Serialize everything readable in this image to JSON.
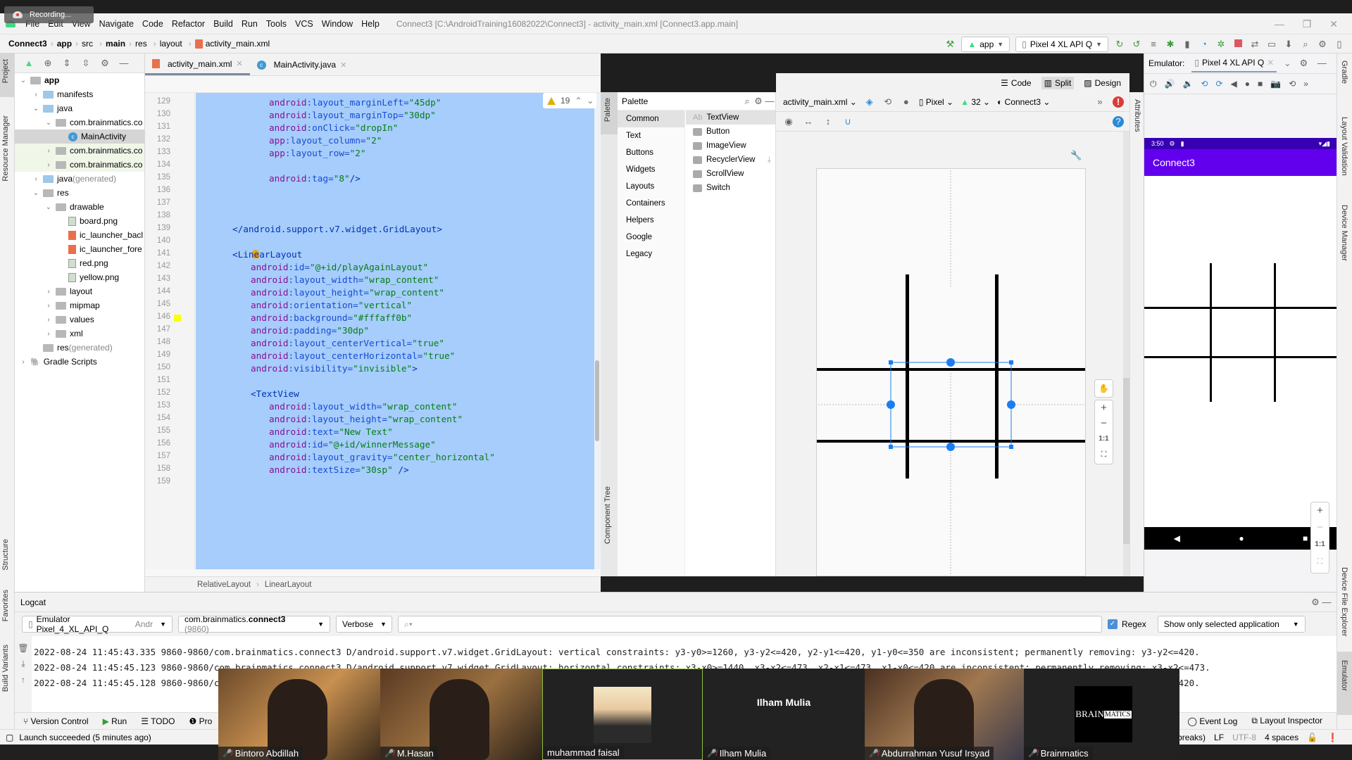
{
  "recording": {
    "label": "Recording..."
  },
  "menu": {
    "items": [
      "File",
      "Edit",
      "View",
      "Navigate",
      "Code",
      "Refactor",
      "Build",
      "Run",
      "Tools",
      "VCS",
      "Window",
      "Help"
    ],
    "window_title": "Connect3 [C:\\AndroidTraining16082022\\Connect3] - activity_main.xml [Connect3.app.main]"
  },
  "breadcrumb": [
    "Connect3",
    "app",
    "src",
    "main",
    "res",
    "layout",
    "activity_main.xml"
  ],
  "toolbar": {
    "run_config": "app",
    "device": "Pixel 4 XL API Q"
  },
  "project_tree": [
    {
      "label": "app",
      "indent": 0,
      "arrow": "v",
      "icon": "module",
      "bold": true
    },
    {
      "label": "manifests",
      "indent": 1,
      "arrow": ">",
      "icon": "folder-blue"
    },
    {
      "label": "java",
      "indent": 1,
      "arrow": "v",
      "icon": "folder-blue"
    },
    {
      "label": "com.brainmatics.co",
      "indent": 2,
      "arrow": "v",
      "icon": "package"
    },
    {
      "label": "MainActivity",
      "indent": 3,
      "arrow": "",
      "icon": "class",
      "selected": true
    },
    {
      "label": "com.brainmatics.co",
      "indent": 2,
      "arrow": ">",
      "icon": "package",
      "modified": true
    },
    {
      "label": "com.brainmatics.co",
      "indent": 2,
      "arrow": ">",
      "icon": "package",
      "modified": true
    },
    {
      "label": "java",
      "suffix": " (generated)",
      "indent": 1,
      "arrow": ">",
      "icon": "folder-gen"
    },
    {
      "label": "res",
      "indent": 1,
      "arrow": "v",
      "icon": "folder-res"
    },
    {
      "label": "drawable",
      "indent": 2,
      "arrow": "v",
      "icon": "folder"
    },
    {
      "label": "board.png",
      "indent": 3,
      "arrow": "",
      "icon": "image"
    },
    {
      "label": "ic_launcher_bacl",
      "indent": 3,
      "arrow": "",
      "icon": "xml"
    },
    {
      "label": "ic_launcher_fore",
      "indent": 3,
      "arrow": "",
      "icon": "xml"
    },
    {
      "label": "red.png",
      "indent": 3,
      "arrow": "",
      "icon": "image"
    },
    {
      "label": "yellow.png",
      "indent": 3,
      "arrow": "",
      "icon": "image"
    },
    {
      "label": "layout",
      "indent": 2,
      "arrow": ">",
      "icon": "folder"
    },
    {
      "label": "mipmap",
      "indent": 2,
      "arrow": ">",
      "icon": "folder"
    },
    {
      "label": "values",
      "indent": 2,
      "arrow": ">",
      "icon": "folder"
    },
    {
      "label": "xml",
      "indent": 2,
      "arrow": ">",
      "icon": "folder"
    },
    {
      "label": "res",
      "suffix": " (generated)",
      "indent": 1,
      "arrow": "",
      "icon": "folder-res"
    },
    {
      "label": "Gradle Scripts",
      "indent": 0,
      "arrow": ">",
      "icon": "gradle"
    }
  ],
  "left_tool_tabs": [
    "Project",
    "Resource Manager",
    "Structure",
    "Favorites",
    "Build Variants"
  ],
  "right_tool_tabs": [
    "Gradle",
    "Layout Validation",
    "Device Manager",
    "Device File Explorer",
    "Emulator"
  ],
  "editor": {
    "tabs": [
      {
        "label": "activity_main.xml",
        "icon": "xml",
        "active": true
      },
      {
        "label": "MainActivity.java",
        "icon": "class",
        "active": false
      }
    ],
    "warnings": "19",
    "lines": [
      {
        "n": "129",
        "indent": 6,
        "parts": [
          [
            "attr",
            "android"
          ],
          [
            "nm",
            ":layout_marginLeft="
          ],
          [
            "val",
            "\"45dp\""
          ]
        ]
      },
      {
        "n": "130",
        "indent": 6,
        "parts": [
          [
            "attr",
            "android"
          ],
          [
            "nm",
            ":layout_marginTop="
          ],
          [
            "val",
            "\"30dp\""
          ]
        ]
      },
      {
        "n": "131",
        "indent": 6,
        "parts": [
          [
            "attr",
            "android"
          ],
          [
            "nm",
            ":onClick="
          ],
          [
            "val",
            "\"dropIn\""
          ]
        ]
      },
      {
        "n": "132",
        "indent": 6,
        "parts": [
          [
            "attr",
            "app"
          ],
          [
            "nm",
            ":layout_column="
          ],
          [
            "val",
            "\"2\""
          ]
        ]
      },
      {
        "n": "133",
        "indent": 6,
        "parts": [
          [
            "attr",
            "app"
          ],
          [
            "nm",
            ":layout_row="
          ],
          [
            "val",
            "\"2\""
          ]
        ]
      },
      {
        "n": "134",
        "indent": 0,
        "parts": []
      },
      {
        "n": "135",
        "indent": 6,
        "parts": [
          [
            "attr",
            "android"
          ],
          [
            "nm",
            ":tag="
          ],
          [
            "val",
            "\"8\""
          ],
          [
            "tag",
            "/>"
          ]
        ]
      },
      {
        "n": "136",
        "indent": 0,
        "parts": []
      },
      {
        "n": "137",
        "indent": 0,
        "parts": []
      },
      {
        "n": "138",
        "indent": 0,
        "parts": []
      },
      {
        "n": "139",
        "indent": 2,
        "parts": [
          [
            "tag",
            "</android.support.v7.widget.GridLayout>"
          ]
        ]
      },
      {
        "n": "140",
        "indent": 0,
        "parts": []
      },
      {
        "n": "141",
        "indent": 2,
        "parts": [
          [
            "tag",
            "<LinearLayout"
          ]
        ]
      },
      {
        "n": "142",
        "indent": 4,
        "parts": [
          [
            "attr",
            "android"
          ],
          [
            "nm",
            ":id="
          ],
          [
            "val",
            "\"@+id/playAgainLayout\""
          ]
        ]
      },
      {
        "n": "143",
        "indent": 4,
        "parts": [
          [
            "attr",
            "android"
          ],
          [
            "nm",
            ":layout_width="
          ],
          [
            "val",
            "\"wrap_content\""
          ]
        ]
      },
      {
        "n": "144",
        "indent": 4,
        "parts": [
          [
            "attr",
            "android"
          ],
          [
            "nm",
            ":layout_height="
          ],
          [
            "val",
            "\"wrap_content\""
          ]
        ]
      },
      {
        "n": "145",
        "indent": 4,
        "parts": [
          [
            "attr",
            "android"
          ],
          [
            "nm",
            ":orientation="
          ],
          [
            "val",
            "\"vertical\""
          ]
        ]
      },
      {
        "n": "146",
        "indent": 4,
        "parts": [
          [
            "attr",
            "android"
          ],
          [
            "nm",
            ":background="
          ],
          [
            "val",
            "\"#fffaff0b\""
          ]
        ]
      },
      {
        "n": "147",
        "indent": 4,
        "parts": [
          [
            "attr",
            "android"
          ],
          [
            "nm",
            ":padding="
          ],
          [
            "val",
            "\"30dp\""
          ]
        ]
      },
      {
        "n": "148",
        "indent": 4,
        "parts": [
          [
            "attr",
            "android"
          ],
          [
            "nm",
            ":layout_centerVertical="
          ],
          [
            "val",
            "\"true\""
          ]
        ]
      },
      {
        "n": "149",
        "indent": 4,
        "parts": [
          [
            "attr",
            "android"
          ],
          [
            "nm",
            ":layout_centerHorizontal="
          ],
          [
            "val",
            "\"true\""
          ]
        ]
      },
      {
        "n": "150",
        "indent": 4,
        "parts": [
          [
            "attr",
            "android"
          ],
          [
            "nm",
            ":visibility="
          ],
          [
            "val",
            "\"invisible\""
          ],
          [
            "tag",
            ">"
          ]
        ]
      },
      {
        "n": "151",
        "indent": 0,
        "parts": []
      },
      {
        "n": "152",
        "indent": 4,
        "parts": [
          [
            "tag",
            "<TextView"
          ]
        ]
      },
      {
        "n": "153",
        "indent": 6,
        "parts": [
          [
            "attr",
            "android"
          ],
          [
            "nm",
            ":layout_width="
          ],
          [
            "val",
            "\"wrap_content\""
          ]
        ]
      },
      {
        "n": "154",
        "indent": 6,
        "parts": [
          [
            "attr",
            "android"
          ],
          [
            "nm",
            ":layout_height="
          ],
          [
            "val",
            "\"wrap_content\""
          ]
        ]
      },
      {
        "n": "155",
        "indent": 6,
        "parts": [
          [
            "attr",
            "android"
          ],
          [
            "nm",
            ":text="
          ],
          [
            "val",
            "\"New Text\""
          ]
        ]
      },
      {
        "n": "156",
        "indent": 6,
        "parts": [
          [
            "attr",
            "android"
          ],
          [
            "nm",
            ":id="
          ],
          [
            "val",
            "\"@+id/winnerMessage\""
          ]
        ]
      },
      {
        "n": "157",
        "indent": 6,
        "parts": [
          [
            "attr",
            "android"
          ],
          [
            "nm",
            ":layout_gravity="
          ],
          [
            "val",
            "\"center_horizontal\""
          ]
        ]
      },
      {
        "n": "158",
        "indent": 6,
        "parts": [
          [
            "attr",
            "android"
          ],
          [
            "nm",
            ":textSize="
          ],
          [
            "val",
            "\"30sp\""
          ],
          [
            "tag",
            " />"
          ]
        ]
      },
      {
        "n": "159",
        "indent": 0,
        "parts": []
      }
    ],
    "color_swatch": "#fffaff0b",
    "structure_crumbs": [
      "RelativeLayout",
      "LinearLayout"
    ]
  },
  "view_modes": {
    "code": "Code",
    "split": "Split",
    "design": "Design",
    "active": "Split"
  },
  "palette": {
    "title": "Palette",
    "side_tab": "Palette",
    "component_tree_tab": "Component Tree",
    "categories": [
      "Common",
      "Text",
      "Buttons",
      "Widgets",
      "Layouts",
      "Containers",
      "Helpers",
      "Google",
      "Legacy"
    ],
    "selected_category": "Common",
    "widgets": [
      {
        "label": "TextView",
        "icon": "Ab",
        "selected": true
      },
      {
        "label": "Button",
        "icon": "button"
      },
      {
        "label": "ImageView",
        "icon": "image"
      },
      {
        "label": "RecyclerView",
        "icon": "list",
        "download": true
      },
      {
        "label": "ScrollView",
        "icon": "scroll"
      },
      {
        "label": "Switch",
        "icon": "switch"
      }
    ]
  },
  "design_toolbar": {
    "file": "activity_main.xml",
    "device": "Pixel",
    "api": "32",
    "theme": "Connect3"
  },
  "attributes_tab": "Attributes",
  "zoom_controls": {
    "plus": "+",
    "minus": "−",
    "one_to_one": "1:1"
  },
  "emulator": {
    "label": "Emulator:",
    "tab": "Pixel 4 XL API Q",
    "status_time": "3:50",
    "app_title": "Connect3"
  },
  "logcat": {
    "title": "Logcat",
    "device": "Emulator Pixel_4_XL_API_Q",
    "device_suffix": "Andr",
    "process_pkg": "com.brainmatics.",
    "process_bold": "connect3",
    "process_pid": "(9860)",
    "level": "Verbose",
    "search_placeholder": "Q",
    "regex_label": "Regex",
    "regex_checked": true,
    "filter": "Show only selected application",
    "lines": [
      "2022-08-24 11:45:43.335 9860-9860/com.brainmatics.connect3 D/android.support.v7.widget.GridLayout: vertical constraints: y3-y0>=1260, y3-y2<=420, y2-y1<=420, y1-y0<=350 are inconsistent; permanently removing: y3-y2<=420.",
      "2022-08-24 11:45:45.123 9860-9860/com.brainmatics.connect3 D/android.support.v7.widget.GridLayout: horizontal constraints: x3-x0>=1440, x3-x2<=473, x2-x1<=473, x1-x0<=420 are inconsistent; permanently removing: x3-x2<=473.",
      "2022-08-24 11:45:45.128 9860-9860/com.brainmatics.connect3 D/android.support.v7.widget.GridLayout: vertical constraints: y3-y0>=1260, y3-y2<=420, y2-y1<=420, y1-y0<=350 are inconsistent; permanently removing: y3-y2<=420."
    ]
  },
  "bottom_tools": {
    "left": [
      "Version Control",
      "Run",
      "TODO",
      "Pro"
    ],
    "right": [
      "Event Log",
      "Layout Inspector"
    ]
  },
  "status": {
    "message": "Launch succeeded (5 minutes ago)",
    "right": [
      "9 line breaks)",
      "LF",
      "UTF-8",
      "4 spaces"
    ]
  },
  "video_call": {
    "participants": [
      {
        "name": "Bintoro Abdillah",
        "muted": true,
        "type": "video"
      },
      {
        "name": "M.Hasan",
        "muted": true,
        "type": "video"
      },
      {
        "name": "muhammad faisal",
        "muted": false,
        "type": "photo",
        "active": true
      },
      {
        "name": "Ilham Mulia",
        "muted": true,
        "type": "name-only"
      },
      {
        "name": "Abdurrahman Yusuf Irsyad",
        "muted": true,
        "type": "video"
      },
      {
        "name": "Brainmatics",
        "muted": true,
        "type": "logo",
        "logo_text_a": "BRAIN",
        "logo_text_b": "MATICS"
      }
    ]
  },
  "colors": {
    "selection": "#a6cdfb",
    "app_bar": "#6200ee",
    "status_bar": "#3700b3",
    "blueprint": "#1a7ef2"
  }
}
